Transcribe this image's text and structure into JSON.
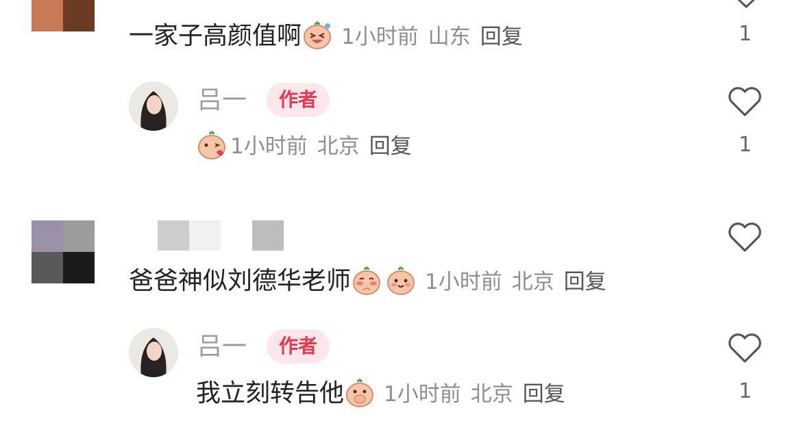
{
  "comments": [
    {
      "text": "一家子高颜值啊",
      "time": "1小时前",
      "location": "山东",
      "reply_label": "回复",
      "likes": "1",
      "emoji": "laughing-face-icon",
      "reply": {
        "author": "吕一",
        "badge": "作者",
        "text": "",
        "time": "1小时前",
        "location": "北京",
        "reply_label": "回复",
        "likes": "1",
        "emoji": "kiss-face-icon"
      }
    },
    {
      "text": "爸爸神似刘德华老师",
      "time": "1小时前",
      "location": "北京",
      "reply_label": "回复",
      "emoji": "blushing-faces-icon",
      "reply": {
        "author": "吕一",
        "badge": "作者",
        "text": "我立刻转告他",
        "time": "1小时前",
        "location": "北京",
        "reply_label": "回复",
        "likes": "1",
        "emoji": "covering-mouth-face-icon"
      }
    }
  ],
  "colors": {
    "badge_bg": "#fde7ea",
    "badge_text": "#e6384d",
    "meta": "#8e8e8e"
  }
}
